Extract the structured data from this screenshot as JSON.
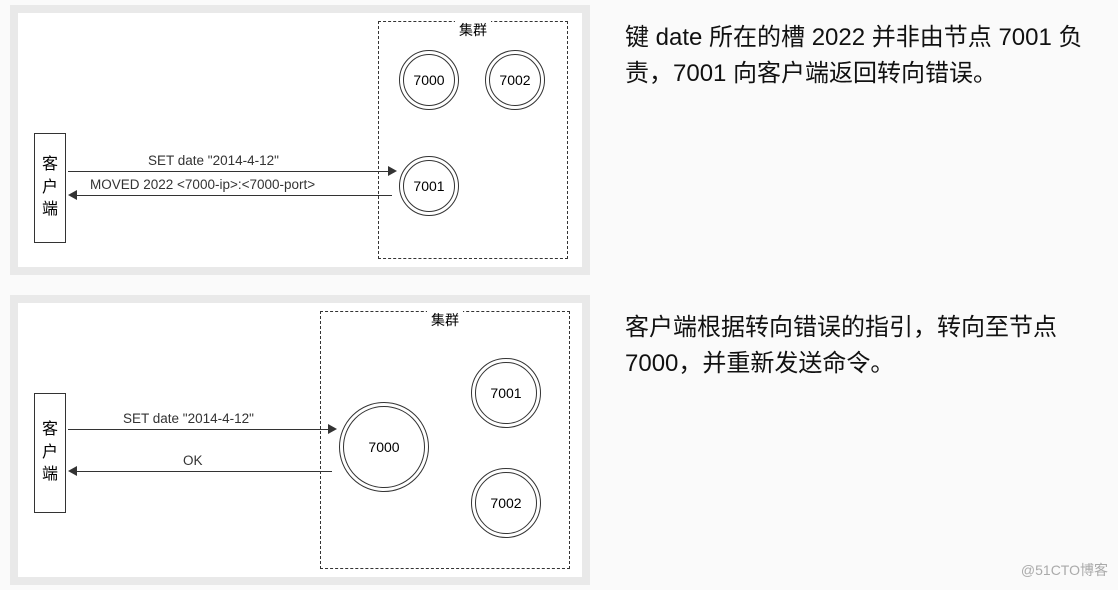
{
  "diagram1": {
    "client_label_chars": [
      "客",
      "户",
      "端"
    ],
    "cluster_label": "集群",
    "nodes": {
      "n7000": "7000",
      "n7001": "7001",
      "n7002": "7002"
    },
    "arrow_request": "SET date \"2014-4-12\"",
    "arrow_response": "MOVED 2022 <7000-ip>:<7000-port>"
  },
  "explain1": "键 date 所在的槽 2022 并非由节点 7001 负责，7001 向客户端返回转向错误。",
  "diagram2": {
    "client_label_chars": [
      "客",
      "户",
      "端"
    ],
    "cluster_label": "集群",
    "nodes": {
      "n7000": "7000",
      "n7001": "7001",
      "n7002": "7002"
    },
    "arrow_request": "SET date \"2014-4-12\"",
    "arrow_response": "OK"
  },
  "explain2": "客户端根据转向错误的指引，转向至节点 7000，并重新发送命令。",
  "watermark": "@51CTO博客"
}
